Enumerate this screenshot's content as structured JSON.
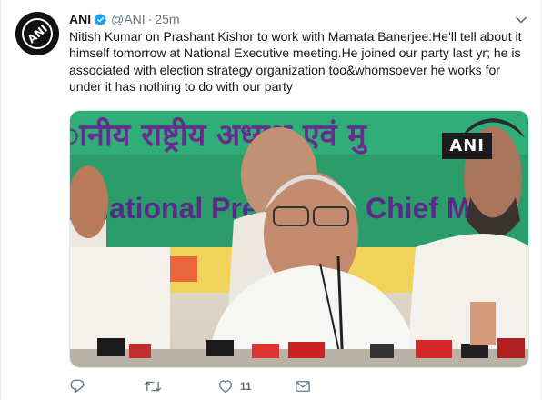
{
  "tweet": {
    "author_name": "ANI",
    "handle": "@ANI",
    "separator": "·",
    "time": "25m",
    "text": "Nitish Kumar on Prashant Kishor to work with Mamata Banerjee:He'll tell about it himself tomorrow at National Executive meeting.He joined our party last yr; he is associated with election strategy organization too&whomsoever he works for under it has nothing to do with our party",
    "avatar_logo_text": "ANI",
    "media": {
      "watermark": "ANI",
      "banner_hindi_text": "ानीय राष्ट्रीय अध्यक्ष एवं मु",
      "banner_english_text": "National Pres",
      "banner_english_text2": "Chief M"
    },
    "actions": {
      "reply_icon": "reply-icon",
      "retweet_icon": "retweet-icon",
      "like_icon": "heart-icon",
      "like_count": "11",
      "dm_icon": "envelope-icon"
    }
  },
  "colors": {
    "verified": "#1da1f2",
    "secondary_text": "#657786",
    "banner_green": "#2a9d6b"
  }
}
